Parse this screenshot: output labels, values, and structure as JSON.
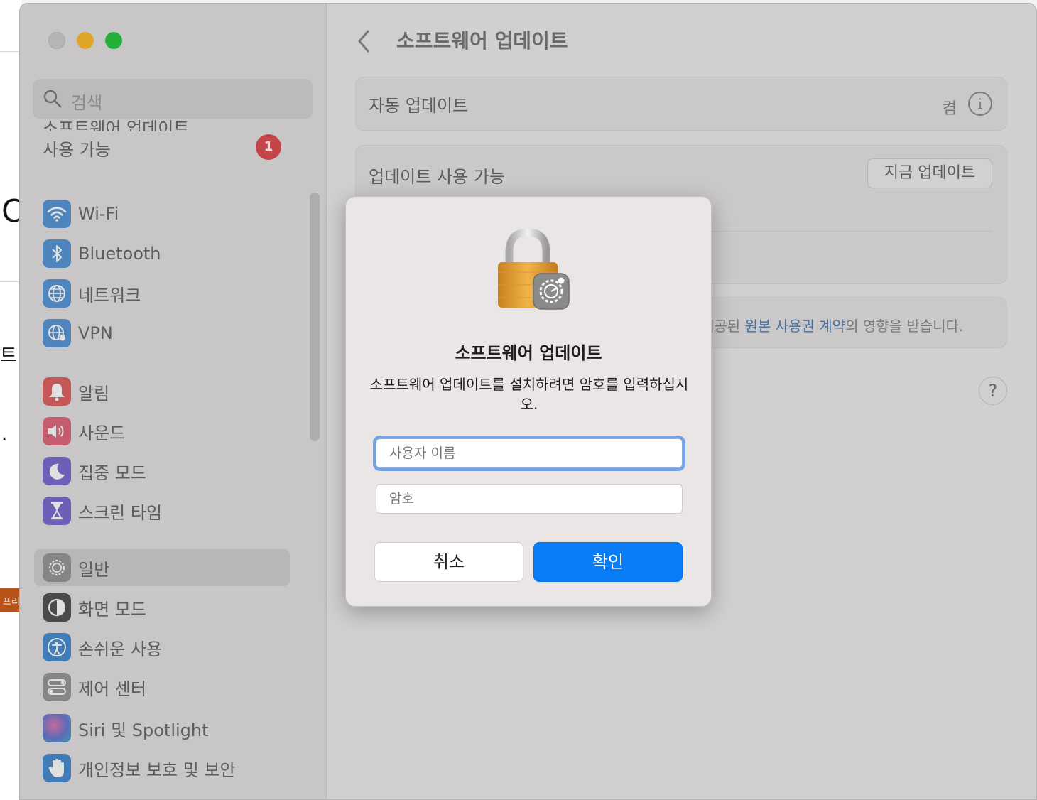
{
  "sidebar": {
    "search_placeholder": "검색",
    "update_notice": {
      "line1": "소프트웨어 업데이트",
      "line2": "사용 가능",
      "badge": "1"
    },
    "items": [
      {
        "label": "Wi-Fi",
        "icon": "wifi-icon",
        "color": "#5b98d8"
      },
      {
        "label": "Bluetooth",
        "icon": "bluetooth-icon",
        "color": "#5b98d8"
      },
      {
        "label": "네트워크",
        "icon": "globe-icon",
        "color": "#5b98d8"
      },
      {
        "label": "VPN",
        "icon": "vpn-globe-icon",
        "color": "#5b98d8"
      },
      {
        "label": "알림",
        "icon": "bell-icon",
        "color": "#e06464"
      },
      {
        "label": "사운드",
        "icon": "speaker-icon",
        "color": "#e06a7e"
      },
      {
        "label": "집중 모드",
        "icon": "moon-icon",
        "color": "#7a6ed0"
      },
      {
        "label": "스크린 타임",
        "icon": "hourglass-icon",
        "color": "#7a6ed0"
      },
      {
        "label": "일반",
        "icon": "gear-icon",
        "color": "#9a9898"
      },
      {
        "label": "화면 모드",
        "icon": "appearance-icon",
        "color": "#555555"
      },
      {
        "label": "손쉬운 사용",
        "icon": "accessibility-icon",
        "color": "#4a8ed0"
      },
      {
        "label": "제어 센터",
        "icon": "toggles-icon",
        "color": "#9a9898"
      },
      {
        "label": "Siri 및 Spotlight",
        "icon": "siri-icon",
        "color": "#7c6ab8"
      },
      {
        "label": "개인정보 보호 및 보안",
        "icon": "hand-icon",
        "color": "#4a8ed0"
      }
    ]
  },
  "main": {
    "title": "소프트웨어 업데이트",
    "auto_update": {
      "label": "자동 업데이트",
      "value": "켬"
    },
    "available": {
      "label": "업데이트 사용 가능",
      "button": "지금 업데이트"
    },
    "license": {
      "prefix": "제공된 ",
      "link": "원본 사용권 계약",
      "suffix": "의 영향을 받습니다."
    },
    "help": "?"
  },
  "dialog": {
    "title": "소프트웨어 업데이트",
    "message": "소프트웨어 업데이트를 설치하려면 암호를 입력하십시오.",
    "username_placeholder": "사용자 이름",
    "password_placeholder": "암호",
    "cancel": "취소",
    "ok": "확인"
  },
  "background": {
    "fragment_c": "C",
    "fragment_te": "트",
    "fragment_dot": ".",
    "fragment_orange": "프리"
  },
  "colors": {
    "accent": "#0a7cf5",
    "badge": "#e04f52",
    "link": "#4e7fb8"
  }
}
